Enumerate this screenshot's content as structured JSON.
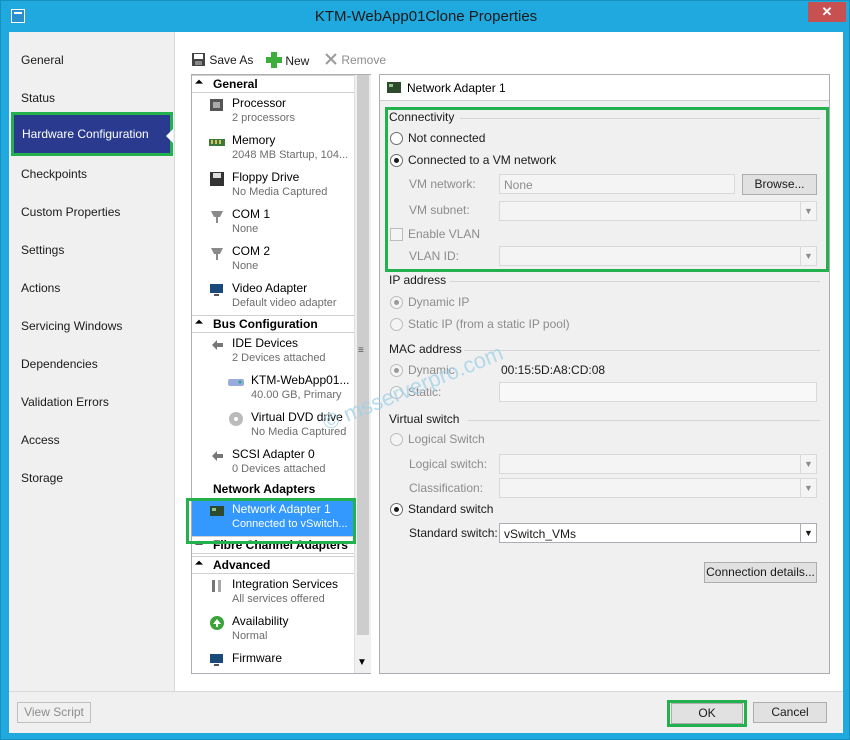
{
  "window": {
    "title": "KTM-WebApp01Clone Properties",
    "close_label": "✕"
  },
  "nav": {
    "items": [
      "General",
      "Status",
      "Hardware Configuration",
      "Checkpoints",
      "Custom Properties",
      "Settings",
      "Actions",
      "Servicing Windows",
      "Dependencies",
      "Validation Errors",
      "Access",
      "Storage"
    ],
    "selected": "Hardware Configuration"
  },
  "toolbar": {
    "save_as": "Save As",
    "new": "New",
    "remove": "Remove"
  },
  "tree": {
    "general_header": "General",
    "processor": {
      "title": "Processor",
      "sub": "2 processors"
    },
    "memory": {
      "title": "Memory",
      "sub": "2048 MB Startup, 104..."
    },
    "floppy": {
      "title": "Floppy Drive",
      "sub": "No Media Captured"
    },
    "com1": {
      "title": "COM 1",
      "sub": "None"
    },
    "com2": {
      "title": "COM 2",
      "sub": "None"
    },
    "video": {
      "title": "Video Adapter",
      "sub": "Default video adapter"
    },
    "bus_header": "Bus Configuration",
    "ide": {
      "title": "IDE Devices",
      "sub": "2 Devices attached"
    },
    "disk": {
      "title": "KTM-WebApp01...",
      "sub": "40.00 GB, Primary"
    },
    "dvd": {
      "title": "Virtual DVD drive",
      "sub": "No Media Captured"
    },
    "scsi": {
      "title": "SCSI Adapter 0",
      "sub": "0 Devices attached"
    },
    "network_header": "Network Adapters",
    "nic": {
      "title": "Network Adapter 1",
      "sub": "Connected to vSwitch..."
    },
    "fc_header": "Fibre Channel Adapters",
    "advanced_header": "Advanced",
    "integration": {
      "title": "Integration Services",
      "sub": "All services offered"
    },
    "availability": {
      "title": "Availability",
      "sub": "Normal"
    },
    "firmware": {
      "title": "Firmware"
    }
  },
  "detail": {
    "header": "Network Adapter 1",
    "connectivity": {
      "label": "Connectivity",
      "not_connected": "Not connected",
      "connected_vm": "Connected to a VM network",
      "vm_network_label": "VM network:",
      "vm_network_value": "None",
      "browse": "Browse...",
      "vm_subnet_label": "VM subnet:",
      "enable_vlan": "Enable VLAN",
      "vlan_id_label": "VLAN ID:"
    },
    "ip": {
      "label": "IP address",
      "dynamic": "Dynamic IP",
      "static": "Static IP (from a static IP pool)"
    },
    "mac": {
      "label": "MAC address",
      "dynamic": "Dynamic",
      "dynamic_value": "00:15:5D:A8:CD:08",
      "static": "Static:"
    },
    "vswitch": {
      "label": "Virtual switch",
      "logical": "Logical Switch",
      "logical_switch_label": "Logical switch:",
      "classification_label": "Classification:",
      "standard": "Standard switch",
      "standard_switch_label": "Standard switch:",
      "standard_switch_value": "vSwitch_VMs"
    },
    "connection_details": "Connection details..."
  },
  "footer": {
    "view_script": "View Script",
    "ok": "OK",
    "cancel": "Cancel"
  },
  "watermark": "© msserverpro.com",
  "colors": {
    "titlebar": "#1fa9de",
    "nav_selected": "#2a3b8f",
    "highlight": "#22b14c",
    "tree_selected": "#3399ff"
  }
}
